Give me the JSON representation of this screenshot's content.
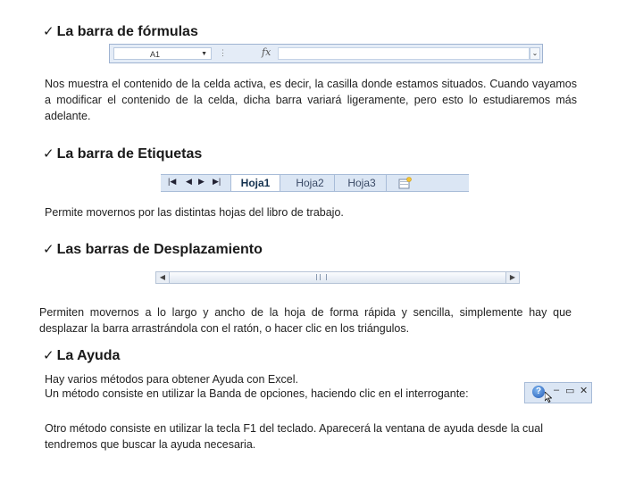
{
  "sections": {
    "formulas": {
      "heading": "La barra de fórmulas",
      "description": "Nos muestra el contenido de la celda activa, es decir, la casilla donde estamos situados. Cuando vayamos a modificar el contenido de la celda, dicha barra variará ligeramente, pero esto lo estudiaremos más adelante.",
      "formula_bar": {
        "cell_name": "A1",
        "fx_label": "fx"
      }
    },
    "tabs": {
      "heading": "La barra de Etiquetas",
      "description": "Permite movernos por las distintas hojas del libro de trabajo.",
      "sheet_tabs": [
        "Hoja1",
        "Hoja2",
        "Hoja3"
      ],
      "active_tab": "Hoja1"
    },
    "scroll": {
      "heading": "Las barras de Desplazamiento",
      "description": "Permiten movernos a lo largo y ancho de la hoja de forma rápida y sencilla, simplemente hay que desplazar la barra arrastrándola con el ratón, o hacer clic en los triángulos."
    },
    "help": {
      "heading": "La Ayuda",
      "line1": "Hay  varios métodos para obtener Ayuda con Excel.",
      "line2": "Un método consiste en utilizar la Banda de opciones, haciendo clic en el interrogante:",
      "line3": "Otro método consiste en utilizar la tecla F1 del teclado. Aparecerá la ventana de ayuda desde la cual tendremos que buscar la ayuda necesaria."
    }
  },
  "bullet_glyph": "✓",
  "icons": [
    "check-bullet-icon",
    "dropdown-arrow-icon",
    "fx-icon",
    "expand-icon",
    "first-sheet-icon",
    "prev-sheet-icon",
    "next-sheet-icon",
    "last-sheet-icon",
    "insert-sheet-icon",
    "scroll-left-icon",
    "scroll-right-icon",
    "scroll-grip-icon",
    "help-question-icon",
    "minimize-icon",
    "restore-icon",
    "close-icon",
    "mouse-cursor-icon"
  ],
  "colors": {
    "bar_bg": "#dbe6f4",
    "bar_border": "#a8bcd8",
    "tab_text": "#3a4a66"
  }
}
